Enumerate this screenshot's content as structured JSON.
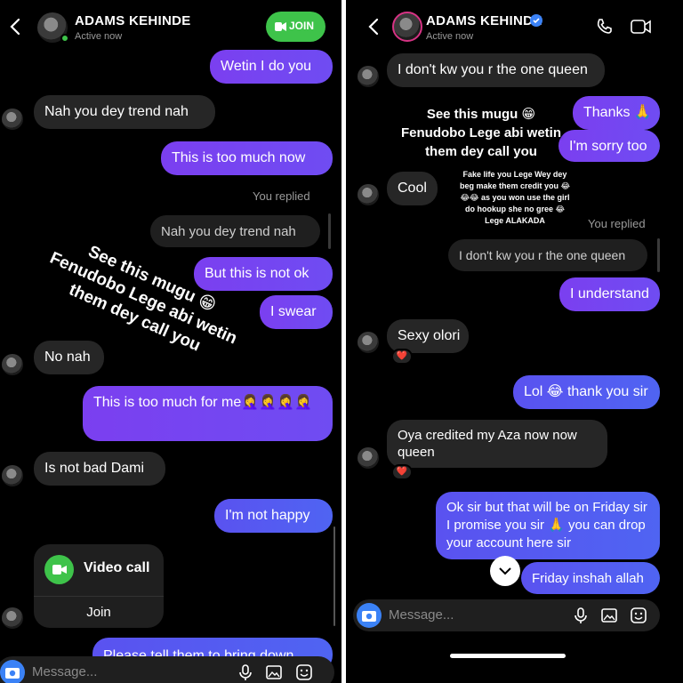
{
  "left": {
    "header": {
      "name": "ADAMS KEHINDE",
      "status": "Active now",
      "join_label": "JOIN"
    },
    "messages": {
      "m1": "Wetin I do you",
      "m2": "Nah you dey trend nah",
      "m3": "This is too much now",
      "replied": "You replied",
      "quoted": "Nah you dey trend nah",
      "m4": "But this is not ok",
      "m5": "I swear",
      "m6": "No nah",
      "m7": "This is too much for me🤦‍♀️🤦‍♀️🤦‍♀️🤦‍♀️",
      "m8": "Is not bad Dami",
      "m9": "I'm not happy",
      "m10": "Please tell them to bring down"
    },
    "overlay": "See this mugu 😁\nFenudobo Lege abi wetin\nthem dey call you",
    "video_call": {
      "title": "Video call",
      "join": "Join"
    },
    "composer_placeholder": "Message..."
  },
  "right": {
    "header": {
      "name": "ADAMS KEHINDE",
      "status": "Active now"
    },
    "messages": {
      "m1": "I don't kw you r the one queen",
      "m2": "Thanks 🙏",
      "m3": "I'm sorry too",
      "m4": "Cool",
      "replied": "You replied",
      "quoted": "I don't kw you r the one queen",
      "m5": "I understand",
      "m6": "Sexy olori",
      "m7": "Lol 😂 thank you sir",
      "m8": "Oya credited my Aza now now queen",
      "m9": "Ok sir but that will be on Friday sir I promise you sir 🙏 you can drop your account here sir",
      "m10": "Friday inshah allah"
    },
    "overlay_big": "See this mugu 😁\nFenudobo Lege abi wetin\nthem dey call you",
    "overlay_small": "Fake life you Lege Wey dey beg make them credit you 😂😂😂 as you won use the girl do hookup she no gree 😂 Lege ALAKADA",
    "reaction": "❤️",
    "composer_placeholder": "Message..."
  },
  "colors": {
    "outgoing_purple": "#7b3ff0",
    "outgoing_blue": "#4f64f2",
    "incoming": "#262626",
    "join_green": "#3ec34a",
    "background": "#000000"
  }
}
